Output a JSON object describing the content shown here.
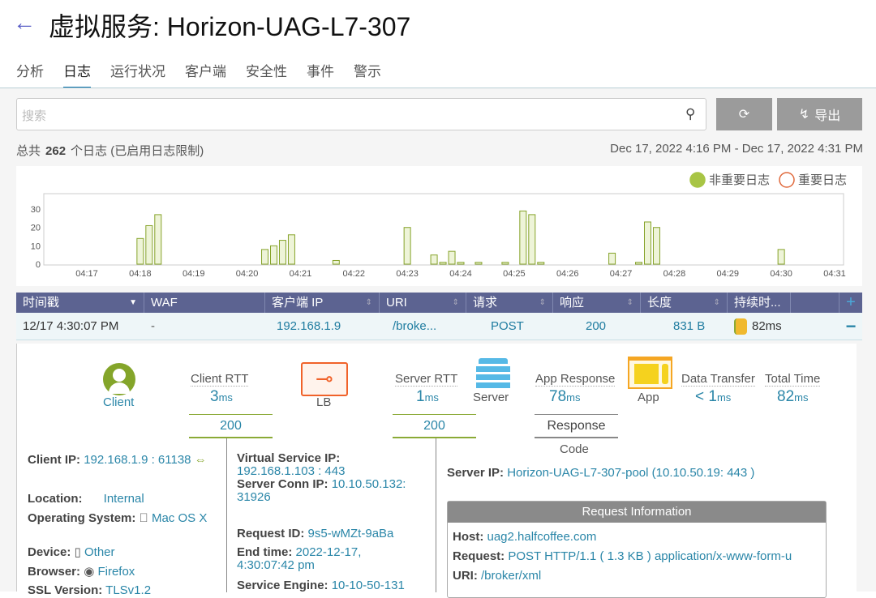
{
  "header": {
    "title": "虚拟服务: Horizon-UAG-L7-307",
    "back_icon": "arrow-left-icon"
  },
  "tabs": [
    {
      "label": "分析"
    },
    {
      "label": "日志",
      "active": true
    },
    {
      "label": "运行状况"
    },
    {
      "label": "客户端"
    },
    {
      "label": "安全性"
    },
    {
      "label": "事件"
    },
    {
      "label": "警示"
    }
  ],
  "toolbar": {
    "search_placeholder": "搜索",
    "export_label": "导出"
  },
  "summary": {
    "prefix": "总共",
    "count": "262",
    "suffix": "个日志 (已启用日志限制)",
    "range": "Dec 17, 2022 4:16 PM - Dec 17, 2022 4:31 PM"
  },
  "chart_data": {
    "type": "bar",
    "legend": [
      {
        "name": "非重要日志",
        "color": "#a8c545"
      },
      {
        "name": "重要日志",
        "color": "#e0693c"
      }
    ],
    "legend_placement": "top-right",
    "xlim": [
      "04:17:00",
      "04:31:00"
    ],
    "ylim": [
      0,
      38
    ],
    "yticks": [
      0,
      10,
      20,
      30
    ],
    "xticks": [
      "04:17",
      "04:18",
      "04:19",
      "04:20",
      "04:21",
      "04:22",
      "04:23",
      "04:24",
      "04:25",
      "04:26",
      "04:27",
      "04:28",
      "04:29",
      "04:30",
      "04:31"
    ],
    "series": [
      {
        "name": "非重要日志",
        "points": [
          [
            "04:18:00",
            14
          ],
          [
            "04:18:10",
            21
          ],
          [
            "04:18:20",
            27
          ],
          [
            "04:20:20",
            8
          ],
          [
            "04:20:30",
            10
          ],
          [
            "04:20:40",
            13
          ],
          [
            "04:20:50",
            16
          ],
          [
            "04:21:40",
            2
          ],
          [
            "04:23:00",
            20
          ],
          [
            "04:23:30",
            5
          ],
          [
            "04:23:40",
            1
          ],
          [
            "04:23:50",
            7
          ],
          [
            "04:24:00",
            1
          ],
          [
            "04:24:20",
            1
          ],
          [
            "04:24:50",
            1
          ],
          [
            "04:25:10",
            29
          ],
          [
            "04:25:20",
            27
          ],
          [
            "04:25:30",
            1
          ],
          [
            "04:26:50",
            6
          ],
          [
            "04:27:20",
            1
          ],
          [
            "04:27:30",
            23
          ],
          [
            "04:27:40",
            20
          ],
          [
            "04:30:00",
            8
          ]
        ]
      }
    ]
  },
  "table": {
    "columns": [
      "时间戳",
      "WAF",
      "客户端 IP",
      "URI",
      "请求",
      "响应",
      "长度",
      "持续时..."
    ],
    "row": {
      "time": "12/17 4:30:07 PM",
      "waf": "-",
      "client_ip": "192.168.1.9",
      "uri": "/broke...",
      "method": "POST",
      "status": "200",
      "length": "831 B",
      "duration": "82ms"
    }
  },
  "detail": {
    "client": "Client",
    "lb": "LB",
    "server": "Server",
    "app": "App",
    "client_rtt": {
      "label": "Client RTT",
      "value": "3",
      "unit": "ms"
    },
    "server_rtt": {
      "label": "Server RTT",
      "value": "1",
      "unit": "ms"
    },
    "app_response": {
      "label": "App Response",
      "value": "78",
      "unit": "ms"
    },
    "data_transfer": {
      "label": "Data Transfer",
      "value": "< 1",
      "unit": "ms"
    },
    "total_time": {
      "label": "Total Time",
      "value": "82",
      "unit": "ms"
    },
    "code1": "200",
    "code2": "200",
    "response_code_1": "Response",
    "response_code_2": "Code",
    "client_ip_label": "Client IP:",
    "client_ip": "192.168.1.9 : 61138",
    "location_label": "Location:",
    "location": "Internal",
    "os_label": "Operating System:",
    "os": "Mac OS X",
    "device_label": "Device:",
    "device": "Other",
    "browser_label": "Browser:",
    "browser": "Firefox",
    "ssl_label": "SSL Version:",
    "ssl": "TLSv1.2",
    "vs_ip_label": "Virtual Service IP:",
    "vs_ip": "192.168.1.103 : 443",
    "conn_ip_label": "Server Conn IP:",
    "conn_ip": "10.10.50.132: 31926",
    "req_id_label": "Request ID:",
    "req_id": "9s5-wMZt-9aBa",
    "end_label": "End time:",
    "end": "2022-12-17, 4:30:07:42 pm",
    "se_label": "Service Engine:",
    "se": "10-10-50-131",
    "server_ip_label": "Server IP:",
    "server_pool": "Horizon-UAG-L7-307-pool",
    "server_ip": "(10.10.50.19: 443 )",
    "req_info": {
      "title": "Request Information",
      "host_label": "Host:",
      "host": "uag2.halfcoffee.com",
      "request_label": "Request:",
      "request": "POST HTTP/1.1 ( 1.3 KB ) application/x-www-form-u",
      "uri_label": "URI:",
      "uri": "/broker/xml"
    }
  }
}
